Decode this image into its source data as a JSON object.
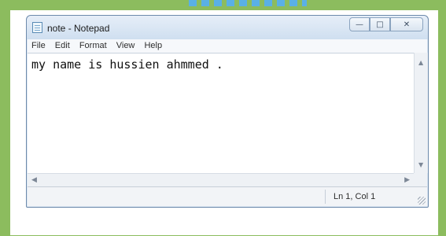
{
  "window": {
    "title": "note - Notepad",
    "controls": {
      "minimize": "—",
      "maximize": "□",
      "close": "✕"
    }
  },
  "menu": [
    "File",
    "Edit",
    "Format",
    "View",
    "Help"
  ],
  "editor": {
    "text": "my name is hussien ahmmed ."
  },
  "statusbar": {
    "position": "Ln 1, Col 1"
  },
  "colors": {
    "frame": "#8cbc5e",
    "accent": "#5ab0e6"
  }
}
